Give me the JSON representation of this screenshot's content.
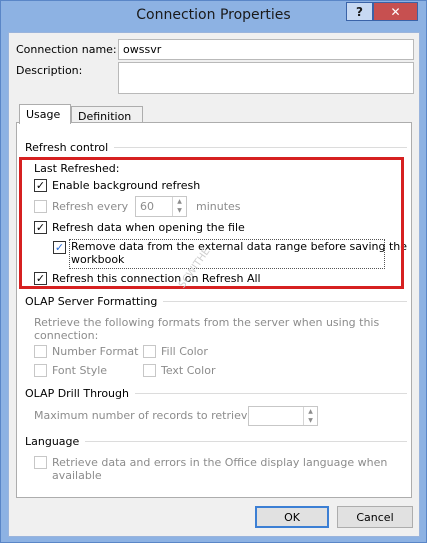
{
  "window": {
    "title": "Connection Properties",
    "help_label": "?",
    "close_label": "✕"
  },
  "connection": {
    "name_label": "Connection name:",
    "name_value": "owssvr",
    "description_label": "Description:",
    "description_value": ""
  },
  "tabs": [
    {
      "label": "Usage",
      "active": true
    },
    {
      "label": "Definition",
      "active": false
    }
  ],
  "refresh_control": {
    "section_label": "Refresh control",
    "last_refreshed_label": "Last Refreshed:",
    "enable_background_refresh": {
      "label": "Enable background refresh",
      "checked": true
    },
    "refresh_every": {
      "label": "Refresh every",
      "checked": false,
      "value": "60",
      "unit": "minutes"
    },
    "refresh_on_open": {
      "label": "Refresh data when opening the file",
      "checked": true
    },
    "remove_data": {
      "label_line1": "Remove data from the external data range before saving the",
      "label_line2": "workbook",
      "checked": true
    },
    "refresh_all": {
      "label": "Refresh this connection on Refresh All",
      "checked": true
    }
  },
  "olap_formatting": {
    "section_label": "OLAP Server Formatting",
    "description_line1": "Retrieve the following formats from the server when using this",
    "description_line2": "connection:",
    "number_format": "Number Format",
    "fill_color": "Fill Color",
    "font_style": "Font Style",
    "text_color": "Text Color"
  },
  "olap_drill": {
    "section_label": "OLAP Drill Through",
    "max_records_label": "Maximum number of records to retrieve:",
    "max_records_value": ""
  },
  "language": {
    "section_label": "Language",
    "retrieve_line1": "Retrieve data and errors in the Office display language when",
    "retrieve_line2": "available"
  },
  "watermark": "SCWITHE",
  "buttons": {
    "ok": "OK",
    "cancel": "Cancel"
  }
}
